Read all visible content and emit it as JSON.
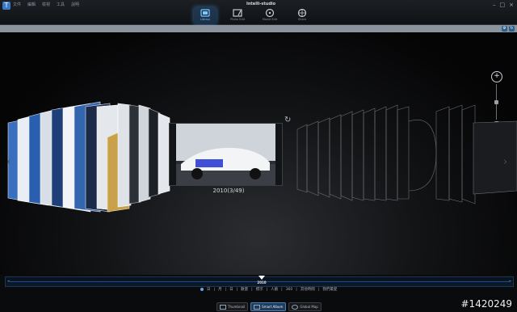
{
  "titlebar": {
    "app_icon": "T",
    "menu_items": [
      "文件",
      "編輯",
      "檢視",
      "工具",
      "說明"
    ],
    "brand": "Intelli-studio",
    "window_controls": [
      "–",
      "□",
      "×"
    ]
  },
  "modes": [
    {
      "label": "Library",
      "icon": "library-icon",
      "active": true
    },
    {
      "label": "Photo Edit",
      "icon": "photo-edit-icon",
      "active": false
    },
    {
      "label": "Movie Edit",
      "icon": "movie-edit-icon",
      "active": false
    },
    {
      "label": "Share",
      "icon": "share-icon",
      "active": false
    }
  ],
  "toolbar": {
    "buttons": [
      "⚙",
      "↻"
    ]
  },
  "zoom": {
    "in_label": "+",
    "out_label": "−"
  },
  "flow": {
    "center_label": "2010(3/49)",
    "rotate_icon": "↻",
    "prev_arrow": "‹",
    "next_arrow": "›"
  },
  "timeline": {
    "year": "2010",
    "left_arrow": "◂",
    "right_arrow": "▸"
  },
  "navbar": [
    "日",
    "月",
    "日",
    "數量",
    "標示",
    "人臉",
    "360",
    "其他時間",
    "我們最愛"
  ],
  "views": [
    {
      "label": "Thumbnail",
      "active": false
    },
    {
      "label": "Smart Album",
      "active": true
    },
    {
      "label": "Global Map",
      "active": false
    }
  ],
  "watermark": "#1420249",
  "colors": {
    "accent": "#3c8cdc",
    "toolbar": "#8b949d",
    "background": "#0a0b0d"
  }
}
